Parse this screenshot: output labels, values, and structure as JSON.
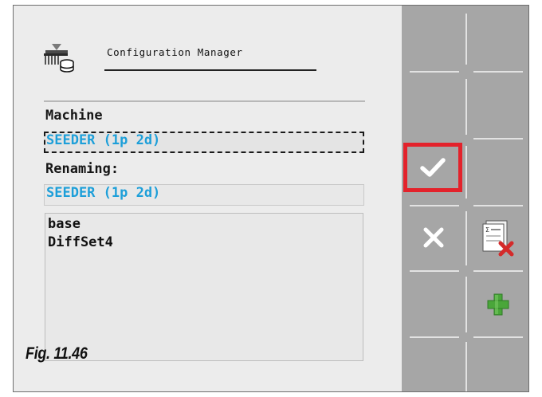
{
  "header": {
    "title": "Configuration Manager",
    "icon": "seeder-database-icon"
  },
  "machine": {
    "label": "Machine",
    "value": "SEEDER (1p 2d)"
  },
  "renaming": {
    "label": "Renaming:",
    "value": "SEEDER (1p 2d)"
  },
  "diffsets": {
    "items": [
      "base",
      "DiffSet4"
    ]
  },
  "softkeys": [
    {
      "id": "confirm",
      "icon": "checkmark-icon",
      "highlighted": true
    },
    {
      "id": "cancel",
      "icon": "close-icon"
    },
    {
      "id": "delete-list",
      "icon": "delete-list-icon"
    },
    {
      "id": "add",
      "icon": "plus-icon"
    }
  ],
  "colors": {
    "value_text": "#1d9fd9",
    "softkey_panel": "#a6a6a6",
    "highlight": "#e3222b",
    "add_icon": "#4aa63a",
    "delete_icon": "#d42a2a"
  },
  "caption": "Fig. 11.46"
}
